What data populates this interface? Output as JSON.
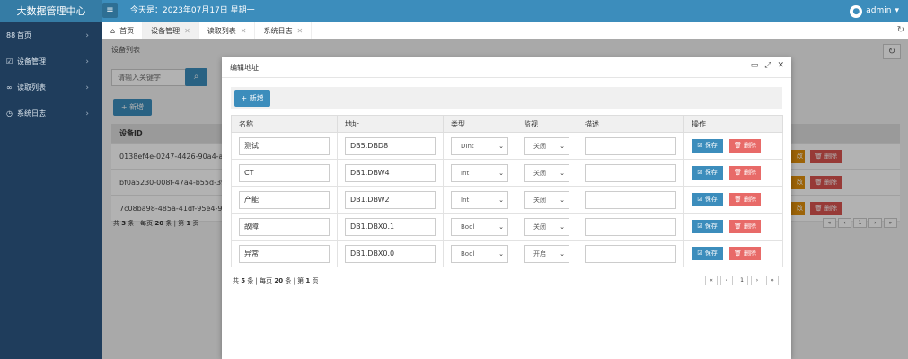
{
  "header": {
    "brand": "大数据管理中心",
    "today": "今天是：2023年07月17日 星期一",
    "user": "admin",
    "menu_icon": "≡",
    "caret": "▾"
  },
  "sidebar": {
    "items": [
      {
        "label": "首页",
        "icon": "88"
      },
      {
        "label": "设备管理",
        "icon": "☑"
      },
      {
        "label": "读取列表",
        "icon": "∞"
      },
      {
        "label": "系统日志",
        "icon": "◷"
      }
    ],
    "chevron": "›"
  },
  "tabs": [
    {
      "label": "首页",
      "icon": "⌂",
      "closable": false,
      "active": false
    },
    {
      "label": "设备管理",
      "closable": true,
      "active": true
    },
    {
      "label": "读取列表",
      "closable": true,
      "active": false
    },
    {
      "label": "系统日志",
      "closable": true,
      "active": false
    }
  ],
  "background": {
    "breadcrumb": "设备列表",
    "search_placeholder": "请输入关键字",
    "add_label": "+ 新增",
    "table": {
      "header": "设备ID",
      "rows": [
        "0138ef4e-0247-4426-90a4-a17a",
        "bf0a5230-008f-47a4-b55d-393c",
        "7c08ba98-485a-41df-95e4-9c29"
      ],
      "edit_label": "改",
      "delete_label": "🗑 删除"
    },
    "footer": {
      "p1": "共 ",
      "total": "3",
      "p2": " 条 | 每页 ",
      "per": "20",
      "p3": " 条 | 第 ",
      "page": "1",
      "p4": " 页"
    },
    "pager": [
      "«",
      "‹",
      "1",
      "›",
      "»"
    ]
  },
  "modal": {
    "title": "编辑地址",
    "controls": [
      "▭",
      "⤢",
      "✕"
    ],
    "add_label": "+ 新增",
    "columns": [
      "名称",
      "地址",
      "类型",
      "监视",
      "描述",
      "操作"
    ],
    "rows": [
      {
        "name": "测试",
        "address": "DB5.DBD8",
        "type": "DInt",
        "monitor": "关闭",
        "desc": ""
      },
      {
        "name": "CT",
        "address": "DB1.DBW4",
        "type": "Int",
        "monitor": "关闭",
        "desc": ""
      },
      {
        "name": "产能",
        "address": "DB1.DBW2",
        "type": "Int",
        "monitor": "关闭",
        "desc": ""
      },
      {
        "name": "故障",
        "address": "DB1.DBX0.1",
        "type": "Bool",
        "monitor": "关闭",
        "desc": ""
      },
      {
        "name": "异常",
        "address": "DB1.DBX0.0",
        "type": "Bool",
        "monitor": "开启",
        "desc": ""
      }
    ],
    "save_label": "☑ 保存",
    "delete_label": "🗑 删除",
    "footer": {
      "p1": "共 ",
      "total": "5",
      "p2": " 条 | 每页 ",
      "per": "20",
      "p3": " 条 | 第 ",
      "page": "1",
      "p4": " 页"
    },
    "pager": [
      "«",
      "‹",
      "1",
      "›",
      "»"
    ]
  }
}
